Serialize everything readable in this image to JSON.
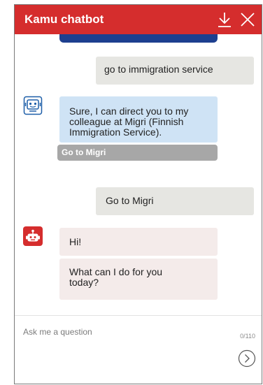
{
  "header": {
    "title": "Kamu chatbot",
    "download_icon": "download-icon",
    "close_icon": "close-icon"
  },
  "messages": [
    {
      "from": "user",
      "text": "go to immigration service"
    },
    {
      "from": "bot",
      "text": "Sure, I can direct you to my colleague at Migri (Finnish Immigration Service)."
    },
    {
      "type": "action-button",
      "label": "Go to Migri"
    },
    {
      "from": "user",
      "text": "Go to Migri"
    },
    {
      "from": "bot",
      "text": "Hi!"
    },
    {
      "from": "bot",
      "text": "What can I do for you today?"
    }
  ],
  "input": {
    "placeholder": "Ask me a question",
    "counter": "0/110",
    "send_icon": "send-icon"
  },
  "colors": {
    "header": "#d52d2d",
    "user_bubble": "#e6e6e2",
    "bot_bubble_blue": "#cfe3f5",
    "bot_bubble_pink": "#f4ebea",
    "action_button": "#a7a7a7",
    "prev_message_strip": "#1d3f8f"
  }
}
